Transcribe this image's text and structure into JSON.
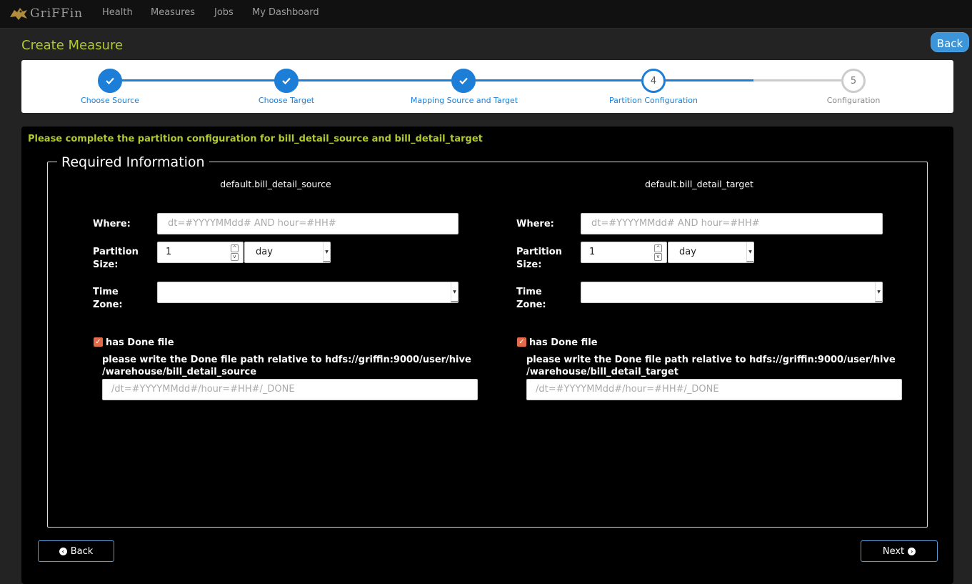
{
  "nav": {
    "brand": "GriFFin",
    "items": [
      "Health",
      "Measures",
      "Jobs",
      "My Dashboard"
    ]
  },
  "page": {
    "title": "Create Measure",
    "back_top": "Back"
  },
  "stepper": {
    "steps": [
      {
        "label": "Choose Source",
        "state": "done"
      },
      {
        "label": "Choose Target",
        "state": "done"
      },
      {
        "label": "Mapping Source and Target",
        "state": "done"
      },
      {
        "label": "Partition Configuration",
        "state": "active",
        "number": "4"
      },
      {
        "label": "Configuration",
        "state": "todo",
        "number": "5"
      }
    ]
  },
  "instruction": "Please complete the partition configuration for bill_detail_source and bill_detail_target",
  "required_legend": "Required Information",
  "labels": {
    "where": "Where:",
    "partition_1": "Partition",
    "partition_2": "Size:",
    "time_1": "Time",
    "time_2": "Zone:",
    "has_done": "has Done file"
  },
  "source": {
    "table": "default.bill_detail_source",
    "where_placeholder": "dt=#YYYYMMdd# AND hour=#HH#",
    "size_value": "1",
    "size_unit": "day",
    "timezone": "",
    "done_desc_1": "please write the Done file path relative to hdfs://griffin:9000/user/hive",
    "done_desc_2": "/warehouse/bill_detail_source",
    "done_placeholder": "/dt=#YYYYMMdd#/hour=#HH#/_DONE"
  },
  "target": {
    "table": "default.bill_detail_target",
    "where_placeholder": "dt=#YYYYMMdd# AND hour=#HH#",
    "size_value": "1",
    "size_unit": "day",
    "timezone": "",
    "done_desc_1": "please write the Done file path relative to hdfs://griffin:9000/user/hive",
    "done_desc_2": "/warehouse/bill_detail_target",
    "done_placeholder": "/dt=#YYYYMMdd#/hour=#HH#/_DONE"
  },
  "buttons": {
    "back": "Back",
    "next": "Next"
  },
  "colors": {
    "accent_green": "#b2c831",
    "step_blue": "#1c7ed6",
    "checkbox": "#e46b4a"
  }
}
